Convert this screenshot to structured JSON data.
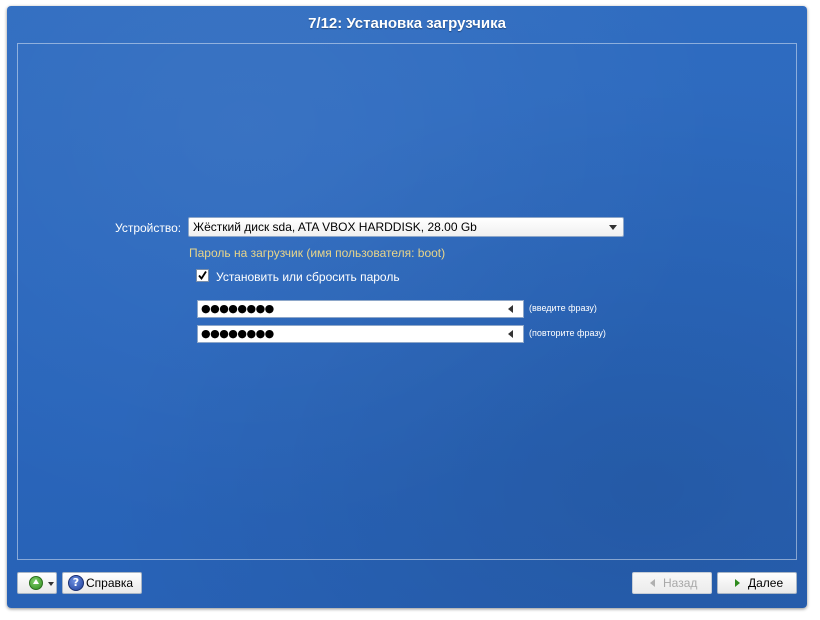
{
  "window": {
    "title": "7/12: Установка загрузчика"
  },
  "form": {
    "device_label": "Устройство:",
    "device_value": "Жёсткий диск sda, ATA VBOX HARDDISK, 28.00 Gb",
    "password_hint": "Пароль на загрузчик (имя пользователя: boot)",
    "set_password_checkbox": {
      "label": "Установить или сбросить пароль",
      "checked": true
    },
    "password_field": {
      "value": "●●●●●●●●",
      "hint": "(введите фразу)"
    },
    "confirm_field": {
      "value": "●●●●●●●●",
      "hint": "(повторите фразу)"
    }
  },
  "footer": {
    "help_label": "Справка",
    "help_icon_glyph": "?",
    "back_label": "Назад",
    "back_enabled": false,
    "next_label": "Далее"
  },
  "colors": {
    "background": "#2a67bd",
    "hint_text": "#e8d58a",
    "text": "#ffffff"
  },
  "icons": {
    "up": "green-up-arrow-icon",
    "help": "help-question-icon",
    "back": "left-arrow-icon",
    "next": "right-arrow-icon"
  }
}
